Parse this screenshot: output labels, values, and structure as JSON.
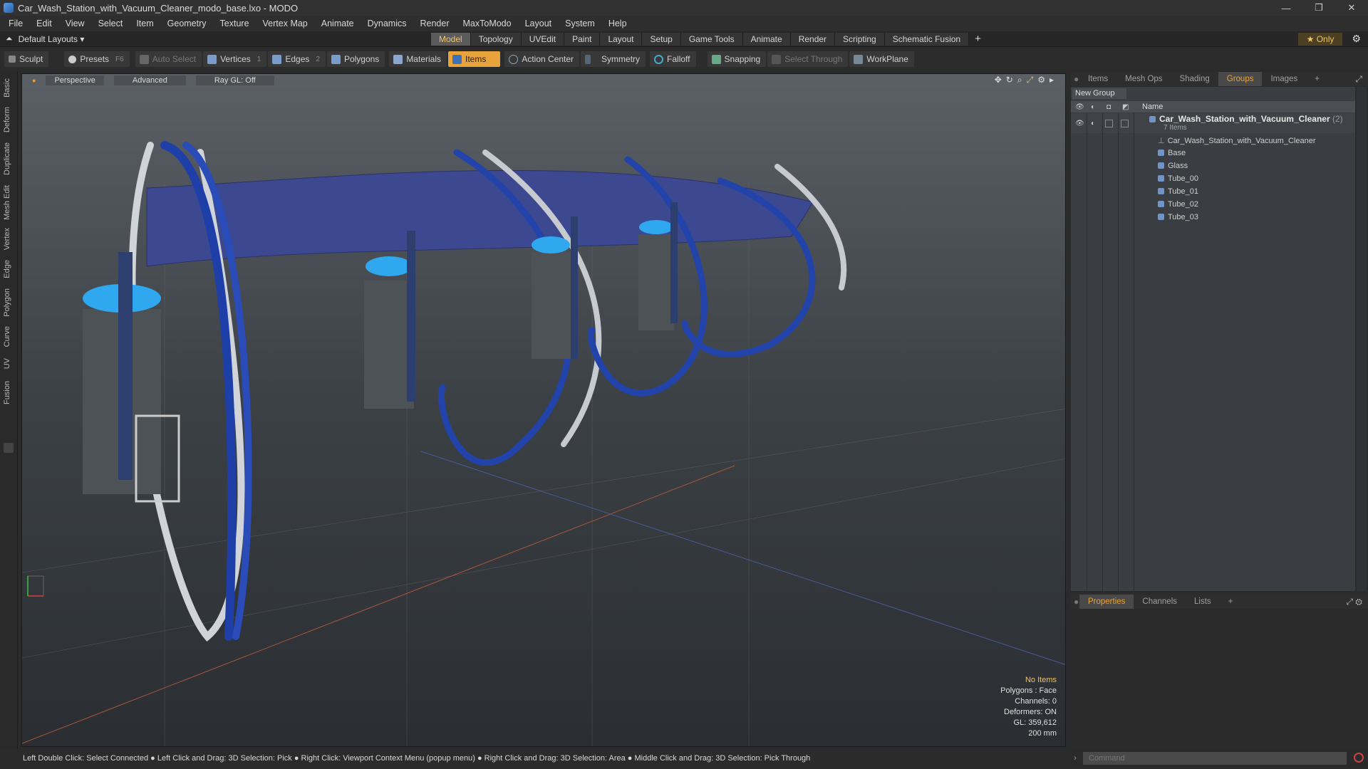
{
  "window": {
    "title": "Car_Wash_Station_with_Vacuum_Cleaner_modo_base.lxo - MODO",
    "controls": [
      "—",
      "❐",
      "✕"
    ]
  },
  "menu": [
    "File",
    "Edit",
    "View",
    "Select",
    "Item",
    "Geometry",
    "Texture",
    "Vertex Map",
    "Animate",
    "Dynamics",
    "Render",
    "MaxToModo",
    "Layout",
    "System",
    "Help"
  ],
  "layout_bar": {
    "layouts_label": "Default Layouts ▾",
    "tabs": [
      "Model",
      "Topology",
      "UVEdit",
      "Paint",
      "Layout",
      "Setup",
      "Game Tools",
      "Animate",
      "Render",
      "Scripting",
      "Schematic Fusion"
    ],
    "active_tab": "Model",
    "only_label": "★  Only"
  },
  "toolbar": {
    "sculpt": "Sculpt",
    "presets": "Presets",
    "presets_key": "F6",
    "auto_select": "Auto Select",
    "vertices": "Vertices",
    "vertices_count": "1",
    "edges": "Edges",
    "edges_count": "2",
    "polygons": "Polygons",
    "materials": "Materials",
    "items": "Items",
    "action_center": "Action Center",
    "symmetry": "Symmetry",
    "falloff": "Falloff",
    "snapping": "Snapping",
    "select_through": "Select Through",
    "workplane": "WorkPlane"
  },
  "left_tabs": [
    "Basic",
    "Deform",
    "Duplicate",
    "Mesh Edit",
    "Vertex",
    "Edge",
    "Polygon",
    "Curve",
    "UV",
    "Fusion"
  ],
  "viewport": {
    "buttons": [
      "Perspective",
      "Advanced",
      "Ray GL: Off"
    ],
    "info": {
      "selection": "No Items",
      "polygons": "Polygons : Face",
      "channels": "Channels: 0",
      "deformers": "Deformers: ON",
      "gl": "GL: 359,612",
      "scale": "200 mm"
    }
  },
  "right_panel": {
    "top_tabs": [
      "Items",
      "Mesh Ops",
      "Shading",
      "Groups",
      "Images"
    ],
    "active_top_tab": "Groups",
    "new_group": "New Group",
    "name_header": "Name",
    "group_name": "Car_Wash_Station_with_Vacuum_Cleaner",
    "group_count": "(2)",
    "group_items": "7 Items",
    "children": [
      "Car_Wash_Station_with_Vacuum_Cleaner",
      "Base",
      "Glass",
      "Tube_00",
      "Tube_01",
      "Tube_02",
      "Tube_03"
    ],
    "bottom_tabs": [
      "Properties",
      "Channels",
      "Lists"
    ],
    "active_bottom_tab": "Properties"
  },
  "command": {
    "placeholder": "Command"
  },
  "status": "Left Double Click: Select Connected ● Left Click and Drag: 3D Selection: Pick ● Right Click: Viewport Context Menu (popup menu) ● Right Click and Drag: 3D Selection: Area ● Middle Click and Drag: 3D Selection: Pick Through"
}
